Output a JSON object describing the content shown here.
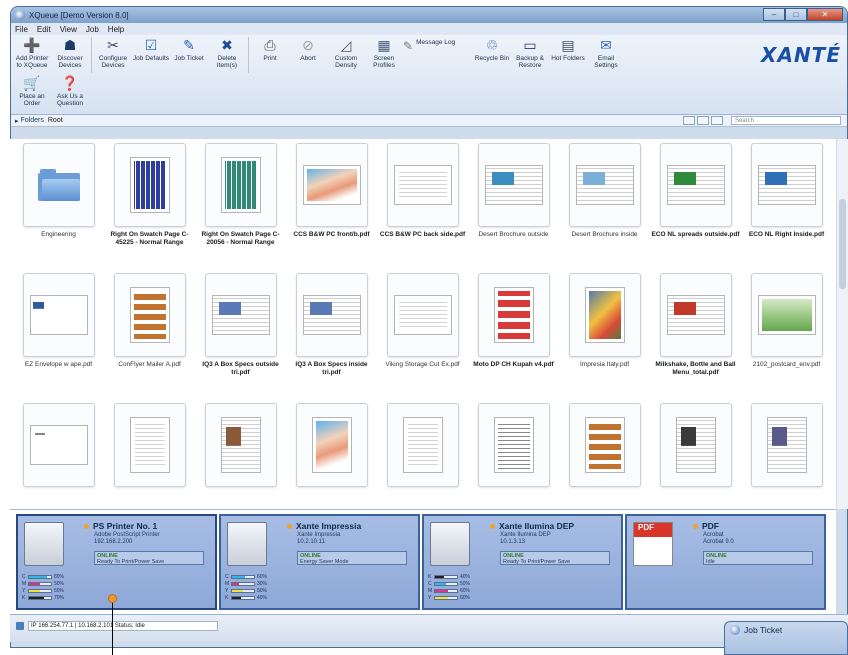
{
  "window": {
    "title": "XQueue [Demo Version 8.0]"
  },
  "menu": [
    "File",
    "Edit",
    "View",
    "Job",
    "Help"
  ],
  "ribbon": {
    "row1": [
      {
        "label": "Add Printer to XQueue",
        "icon": "add-printer-icon",
        "glyph": "➕"
      },
      {
        "label": "Discover Devices",
        "icon": "discover-icon",
        "glyph": "☗"
      },
      {
        "label": "Configure Devices",
        "icon": "configure-icon",
        "glyph": "✂"
      },
      {
        "label": "Job Defaults",
        "icon": "job-defaults-icon",
        "glyph": "☑"
      },
      {
        "label": "Job Ticket",
        "icon": "job-ticket-icon",
        "glyph": "✎"
      },
      {
        "label": "Delete Item(s)",
        "icon": "delete-icon",
        "glyph": "✖"
      },
      {
        "label": "Print",
        "icon": "print-icon",
        "glyph": "⎙"
      },
      {
        "label": "Abort",
        "icon": "abort-icon",
        "glyph": "⊘"
      },
      {
        "label": "Custom Density",
        "icon": "density-icon",
        "glyph": "◿"
      },
      {
        "label": "Screen Profiles",
        "icon": "screen-profiles-icon",
        "glyph": "▦"
      }
    ],
    "message_log": "Message Log",
    "row1_right": [
      {
        "label": "Recycle Bin",
        "icon": "recycle-bin-icon",
        "glyph": "♲"
      },
      {
        "label": "Backup & Restore",
        "icon": "backup-icon",
        "glyph": "▭"
      },
      {
        "label": "Hot Folders",
        "icon": "hot-folders-icon",
        "glyph": "▤"
      },
      {
        "label": "Email Settings",
        "icon": "email-icon",
        "glyph": "✉"
      }
    ],
    "row2": [
      {
        "label": "Place an Order",
        "icon": "cart-icon",
        "glyph": "🛒"
      },
      {
        "label": "Ask Us a Question",
        "icon": "help-icon",
        "glyph": "❓"
      }
    ],
    "logo": "XANTÉ"
  },
  "address": {
    "folders": "Folders",
    "crumb": "Root",
    "search_placeholder": "Search"
  },
  "thumbnails": [
    {
      "label": "Engineering",
      "kind": "folder",
      "bold": false
    },
    {
      "label": "Right On Swatch Page C-45225 - Normal Range",
      "kind": "swatch-blue",
      "bold": true
    },
    {
      "label": "Right On Swatch Page C-20056 - Normal Range",
      "kind": "swatch-green",
      "bold": true
    },
    {
      "label": "CCS B&W PC front/b.pdf",
      "kind": "photo",
      "bold": true
    },
    {
      "label": "CCS B&W PC back side.pdf",
      "kind": "doc",
      "bold": true
    },
    {
      "label": "Desert Brochure outside",
      "kind": "brochure",
      "bold": false
    },
    {
      "label": "Desert Brochure inside",
      "kind": "brochure2",
      "bold": false
    },
    {
      "label": "ECO NL spreads outside.pdf",
      "kind": "spread",
      "bold": true
    },
    {
      "label": "ECO NL Right Inside.pdf",
      "kind": "spread2",
      "bold": true
    },
    {
      "label": "EZ Envelope w ape.pdf",
      "kind": "envelope",
      "bold": false
    },
    {
      "label": "ConFlyer Mailer A.pdf",
      "kind": "labels",
      "bold": false
    },
    {
      "label": "IQ3 A Box Specs outside tri.pdf",
      "kind": "trifold",
      "bold": true
    },
    {
      "label": "IQ3 A Box Specs inside tri.pdf",
      "kind": "trifold2",
      "bold": true
    },
    {
      "label": "Viking Storage Cut Ex.pdf",
      "kind": "doc2",
      "bold": false
    },
    {
      "label": "Moto DP CH Kupah v4.pdf",
      "kind": "coupons",
      "bold": true
    },
    {
      "label": "Impresia Italy.pdf",
      "kind": "poster",
      "bold": false
    },
    {
      "label": "Milkshake, Bottle and Ball Menu_total.pdf",
      "kind": "menu",
      "bold": true
    },
    {
      "label": "2102_postcard_env.pdf",
      "kind": "postcard",
      "bold": false
    },
    {
      "label": "",
      "kind": "envelope2",
      "bold": false
    },
    {
      "label": "",
      "kind": "letter",
      "bold": false
    },
    {
      "label": "",
      "kind": "flyer",
      "bold": false
    },
    {
      "label": "",
      "kind": "portrait",
      "bold": false
    },
    {
      "label": "",
      "kind": "form",
      "bold": false
    },
    {
      "label": "",
      "kind": "form2",
      "bold": false
    },
    {
      "label": "",
      "kind": "tickets",
      "bold": false
    },
    {
      "label": "",
      "kind": "booklet",
      "bold": false
    },
    {
      "label": "",
      "kind": "booklet2",
      "bold": false
    }
  ],
  "printers": [
    {
      "name": "PS Printer No. 1",
      "model": "Adobe PostScript Printer",
      "ip": "192.168.2.200",
      "state": "ONLINE",
      "message": "Ready To Print/Power Save",
      "inks": [
        {
          "k": "C",
          "v": 0.8,
          "c": "#2fb7e8"
        },
        {
          "k": "M",
          "v": 0.5,
          "c": "#e0338a"
        },
        {
          "k": "Y",
          "v": 0.5,
          "c": "#f1e13a"
        },
        {
          "k": "K",
          "v": 0.7,
          "c": "#222222"
        }
      ],
      "ink_labels": [
        "80%",
        "50%",
        "50%",
        "70%"
      ]
    },
    {
      "name": "Xante Impressia",
      "model": "Xante Impressia",
      "ip": "10.2.10.11",
      "state": "ONLINE",
      "message": "Energy Saver Mode",
      "inks": [
        {
          "k": "C",
          "v": 0.6,
          "c": "#2fb7e8"
        },
        {
          "k": "M",
          "v": 0.3,
          "c": "#e0338a"
        },
        {
          "k": "Y",
          "v": 0.5,
          "c": "#f1e13a"
        },
        {
          "k": "K",
          "v": 0.4,
          "c": "#222222"
        }
      ],
      "ink_labels": [
        "60%",
        "30%",
        "50%",
        "40%"
      ]
    },
    {
      "name": "Xante Ilumina DEP",
      "model": "Xante Ilumina DEP",
      "ip": "10.1.3.13",
      "state": "ONLINE",
      "message": "Ready To Print/Power Save",
      "inks": [
        {
          "k": "K",
          "v": 0.4,
          "c": "#222222"
        },
        {
          "k": "C",
          "v": 0.5,
          "c": "#2fb7e8"
        },
        {
          "k": "M",
          "v": 0.6,
          "c": "#e0338a"
        },
        {
          "k": "Y",
          "v": 0.6,
          "c": "#f1e13a"
        }
      ],
      "ink_labels": [
        "40%",
        "50%",
        "60%",
        "60%"
      ]
    },
    {
      "name": "PDF",
      "model": "Acrobat",
      "ip": "Acrobat 9.0",
      "state": "ONLINE",
      "message": "Idle",
      "inks": [],
      "ink_labels": []
    }
  ],
  "status": {
    "text": "IP 166.254.77.1 | 10.168.2.101 Status: Idle"
  },
  "job_ticket": {
    "title": "Job Ticket"
  }
}
